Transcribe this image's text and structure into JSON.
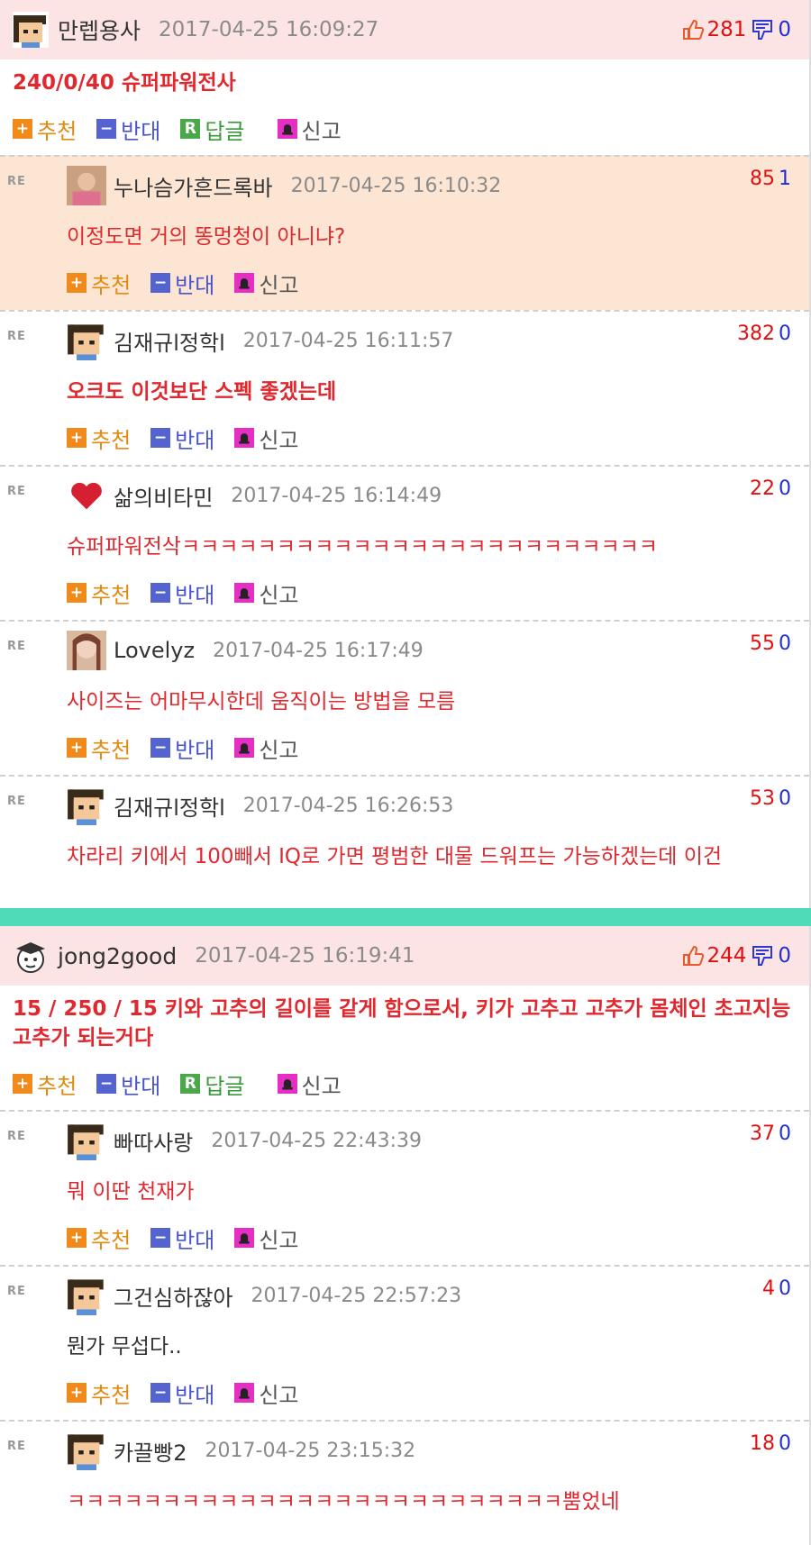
{
  "top": {
    "post": {
      "username": "만렙용사",
      "date": "2017-04-25 16:09:27",
      "upvotes": "281",
      "downvotes": "0",
      "title": "240/0/40 슈퍼파워전사",
      "actions": {
        "up": "추천",
        "down": "반대",
        "reply": "답글",
        "report": "신고"
      }
    },
    "replies": [
      {
        "username": "누나슴가흔드록바",
        "date": "2017-04-25 16:10:32",
        "up": "85",
        "down": "1",
        "text": "이정도면 거의 똥멍청이 아니냐?"
      },
      {
        "username": "김재규l정학l",
        "date": "2017-04-25 16:11:57",
        "up": "382",
        "down": "0",
        "text": "오크도 이것보단 스펙 좋겠는데"
      },
      {
        "username": "삶의비타민",
        "date": "2017-04-25 16:14:49",
        "up": "22",
        "down": "0",
        "text": "슈퍼파워전삭ㅋㅋㅋㅋㅋㅋㅋㅋㅋㅋㅋㅋㅋㅋㅋㅋㅋㅋㅋㅋㅋㅋㅋㅋㅋ"
      },
      {
        "username": "Lovelyz",
        "date": "2017-04-25 16:17:49",
        "up": "55",
        "down": "0",
        "text": "사이즈는 어마무시한데 움직이는 방법을 모름"
      },
      {
        "username": "김재규l정학l",
        "date": "2017-04-25 16:26:53",
        "up": "53",
        "down": "0",
        "text": "차라리 키에서 100빼서 IQ로 가면 평범한 대물 드워프는 가능하겠는데 이건"
      }
    ],
    "reply_actions": {
      "up": "추천",
      "down": "반대",
      "report": "신고"
    }
  },
  "bottom": {
    "post": {
      "username": "jong2good",
      "date": "2017-04-25 16:19:41",
      "upvotes": "244",
      "downvotes": "0",
      "title": "15 / 250 / 15 키와 고추의 길이를 같게 함으로서, 키가 고추고 고추가 몸체인 초고지능 고추가 되는거다",
      "actions": {
        "up": "추천",
        "down": "반대",
        "reply": "답글",
        "report": "신고"
      }
    },
    "replies": [
      {
        "username": "빠따사랑",
        "date": "2017-04-25 22:43:39",
        "up": "37",
        "down": "0",
        "text": "뭐 이딴 천재가"
      },
      {
        "username": "그건심하잖아",
        "date": "2017-04-25 22:57:23",
        "up": "4",
        "down": "0",
        "text": "뭔가 무섭다.."
      },
      {
        "username": "카끌빵2",
        "date": "2017-04-25 23:15:32",
        "up": "18",
        "down": "0",
        "text": "ㅋㅋㅋㅋㅋㅋㅋㅋㅋㅋㅋㅋㅋㅋㅋㅋㅋㅋㅋㅋㅋㅋㅋㅋㅋㅋ뿜었네"
      }
    ],
    "reply_actions": {
      "up": "추천",
      "down": "반대",
      "report": "신고"
    }
  },
  "re_label": "RE",
  "colors": {
    "accent_red": "#e0282f",
    "header_pink": "#fde4e4",
    "highlight": "#fce6d3",
    "divider_handle": "#4fdbb8"
  }
}
